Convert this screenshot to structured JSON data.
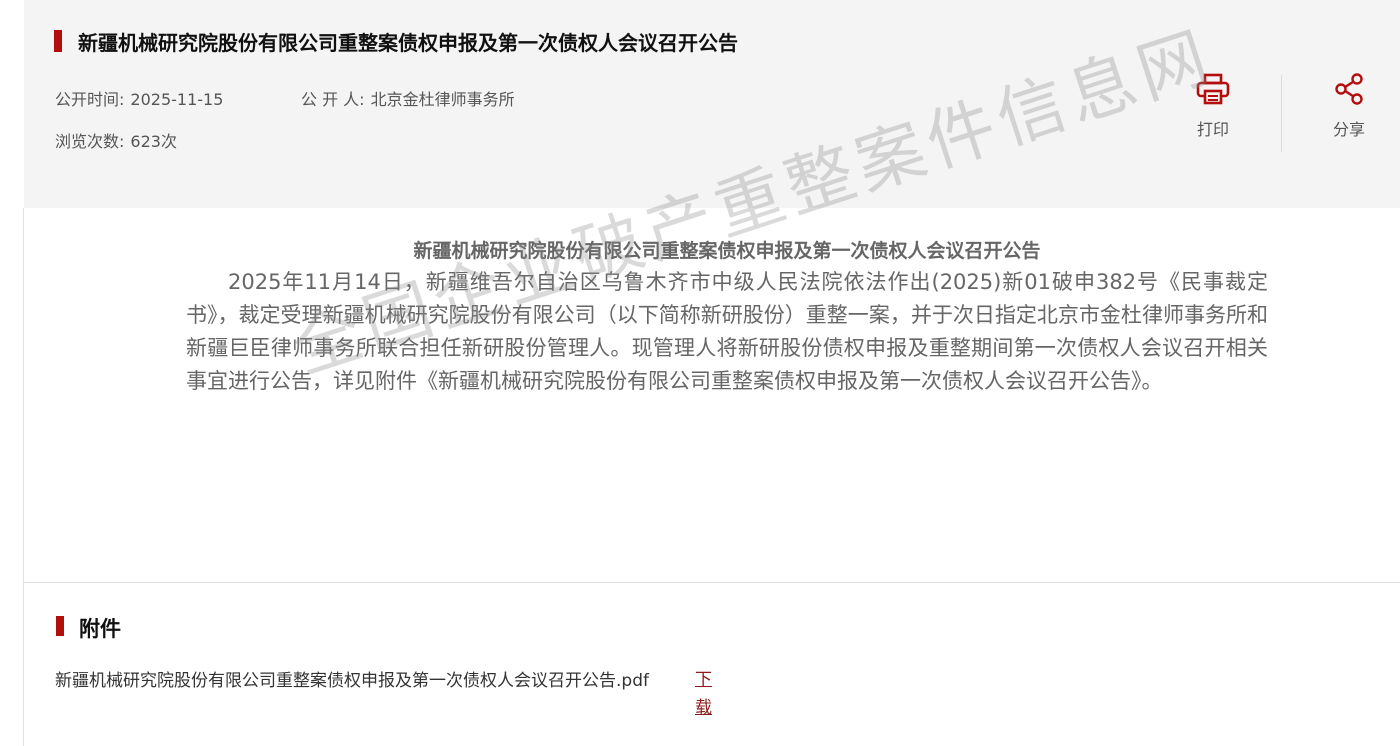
{
  "header": {
    "title": "新疆机械研究院股份有限公司重整案债权申报及第一次债权人会议召开公告",
    "publish_time_label": "公开时间:",
    "publish_time": "2025-11-15",
    "publisher_label": "公 开 人:",
    "publisher": "北京金杜律师事务所",
    "views_label": "浏览次数:",
    "views": "623次"
  },
  "tools": {
    "print_label": "打印",
    "share_label": "分享"
  },
  "article": {
    "title": "新疆机械研究院股份有限公司重整案债权申报及第一次债权人会议召开公告",
    "body": "2025年11月14日，新疆维吾尔自治区乌鲁木齐市中级人民法院依法作出(2025)新01破申382号《民事裁定书》，裁定受理新疆机械研究院股份有限公司（以下简称新研股份）重整一案，并于次日指定北京市金杜律师事务所和新疆巨臣律师事务所联合担任新研股份管理人。现管理人将新研股份债权申报及重整期间第一次债权人会议召开相关事宜进行公告，详见附件《新疆机械研究院股份有限公司重整案债权申报及第一次债权人会议召开公告》。"
  },
  "watermark": "全国企业破产重整案件信息网",
  "attachments": {
    "title": "附件",
    "files": [
      {
        "name": "新疆机械研究院股份有限公司重整案债权申报及第一次债权人会议召开公告.pdf",
        "download_label": "下载"
      }
    ]
  },
  "colors": {
    "accent": "#b40d0d",
    "link": "#8b1a1a"
  }
}
